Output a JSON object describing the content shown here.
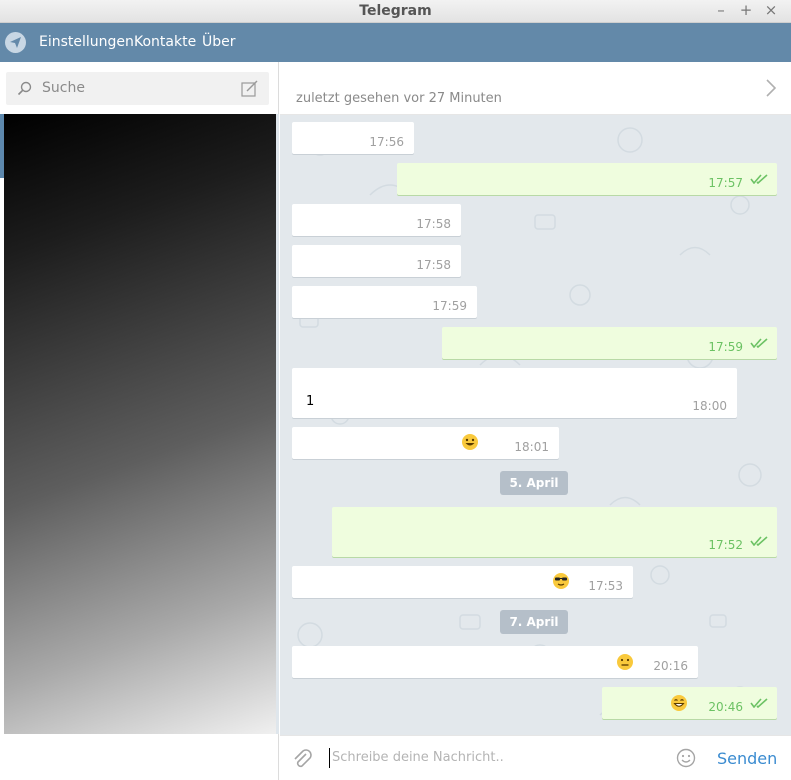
{
  "window": {
    "title": "Telegram",
    "controls": [
      "–",
      "+",
      "×"
    ]
  },
  "menu": {
    "items": [
      "Einstellungen",
      "Kontakte",
      "Über"
    ]
  },
  "search": {
    "placeholder": "Suche"
  },
  "chat": {
    "status": "zuletzt gesehen vor 27 Minuten"
  },
  "messages": [
    {
      "dir": "in",
      "time": "17:56"
    },
    {
      "dir": "out",
      "time": "17:57"
    },
    {
      "dir": "in",
      "time": "17:58"
    },
    {
      "dir": "in",
      "time": "17:58"
    },
    {
      "dir": "in",
      "time": "17:59"
    },
    {
      "dir": "out",
      "time": "17:59"
    },
    {
      "dir": "in",
      "time": "18:00",
      "text": "1"
    },
    {
      "dir": "in",
      "time": "18:01",
      "emoji": "smiley-emoji"
    },
    {
      "dir": "out",
      "time": "17:52"
    },
    {
      "dir": "in",
      "time": "17:53",
      "emoji": "sunglasses-emoji"
    },
    {
      "dir": "in",
      "time": "20:16",
      "emoji": "neutral-face-emoji"
    },
    {
      "dir": "out",
      "time": "20:46",
      "emoji": "grinning-emoji"
    }
  ],
  "dates": [
    "5. April",
    "7. April"
  ],
  "input": {
    "placeholder": "Schreibe deine Nachricht..",
    "send_label": "Senden"
  },
  "colors": {
    "menubar": "#6389a9",
    "outgoing_bubble": "#effdde",
    "check": "#6cc264",
    "accent": "#3a8bd0"
  }
}
